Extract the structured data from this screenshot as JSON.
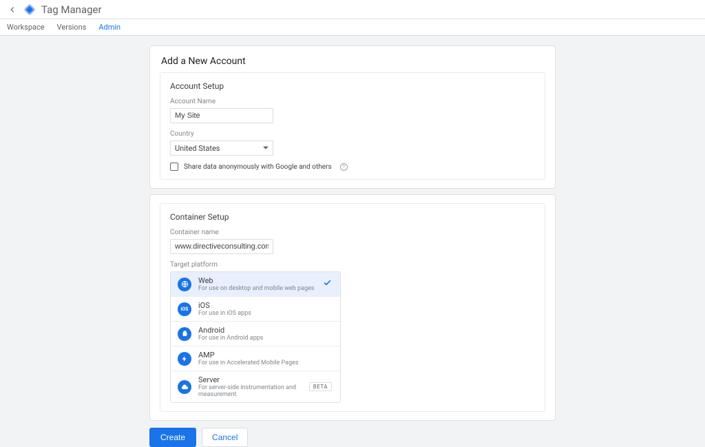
{
  "header": {
    "app_title": "Tag Manager"
  },
  "tabs": {
    "workspace": "Workspace",
    "versions": "Versions",
    "admin": "Admin"
  },
  "page": {
    "title": "Add a New Account"
  },
  "account_setup": {
    "section_title": "Account Setup",
    "name_label": "Account Name",
    "name_value": "My Site",
    "country_label": "Country",
    "country_value": "United States",
    "share_label": "Share data anonymously with Google and others"
  },
  "container_setup": {
    "section_title": "Container Setup",
    "name_label": "Container name",
    "name_value": "www.directiveconsulting.com",
    "target_label": "Target platform",
    "platforms": [
      {
        "name": "Web",
        "desc": "For use on desktop and mobile web pages"
      },
      {
        "name": "iOS",
        "desc": "For use in iOS apps"
      },
      {
        "name": "Android",
        "desc": "For use in Android apps"
      },
      {
        "name": "AMP",
        "desc": "For use in Accelerated Mobile Pages"
      },
      {
        "name": "Server",
        "desc": "For server-side instrumentation and measurement"
      }
    ],
    "beta_label": "BETA"
  },
  "buttons": {
    "create": "Create",
    "cancel": "Cancel"
  }
}
